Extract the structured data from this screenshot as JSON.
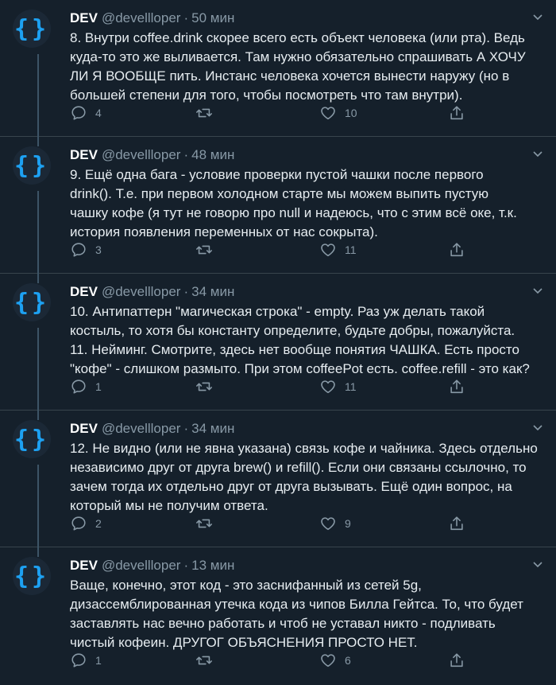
{
  "colors": {
    "background": "#15202b",
    "accent": "#1da1f2",
    "muted": "#8899a6"
  },
  "tweets": [
    {
      "avatar_text": "{}",
      "name": "DEV",
      "handle": "@devellloper",
      "separator": "·",
      "time": "50 мин",
      "text": "8. Внутри coffee.drink скорее всего есть объект человека (или рта). Ведь\nкуда-то это же выливается. Там нужно обязательно спрашивать А ХОЧУ\nЛИ Я ВООБЩЕ пить. Инстанс человека хочется вынести наружу (но в\nбольшей степени для того, чтобы посмотреть что там внутри).",
      "replies": "4",
      "retweets": "",
      "likes": "10"
    },
    {
      "avatar_text": "{}",
      "name": "DEV",
      "handle": "@devellloper",
      "separator": "·",
      "time": "48 мин",
      "text": "9. Ещё одна бага - условие проверки пустой чашки после первого\ndrink(). Т.е. при первом холодном старте мы можем выпить пустую\nчашку кофе (я тут не говорю про null и надеюсь, что с этим всё оке, т.к.\nистория появления переменных от нас сокрыта).",
      "replies": "3",
      "retweets": "",
      "likes": "11"
    },
    {
      "avatar_text": "{}",
      "name": "DEV",
      "handle": "@devellloper",
      "separator": "·",
      "time": "34 мин",
      "text": "10. Антипаттерн \"магическая строка\" - empty. Раз уж делать такой\nкостыль, то хотя бы константу определите, будьте добры, пожалуйста.\n11. Нейминг. Смотрите, здесь нет вообще понятия ЧАШКА. Есть просто\n\"кофе\" - слишком размыто. При этом coffeePot есть. coffee.refill - это как?",
      "replies": "1",
      "retweets": "",
      "likes": "11"
    },
    {
      "avatar_text": "{}",
      "name": "DEV",
      "handle": "@devellloper",
      "separator": "·",
      "time": "34 мин",
      "text": "12. Не видно (или не явна указана) связь кофе и чайника. Здесь отдельно\nнезависимо друг от друга brew() и refill(). Если они связаны ссылочно, то\nзачем тогда их отдельно друг от друга вызывать. Ещё один вопрос, на\nкоторый мы не получим ответа.",
      "replies": "2",
      "retweets": "",
      "likes": "9"
    },
    {
      "avatar_text": "{}",
      "name": "DEV",
      "handle": "@devellloper",
      "separator": "·",
      "time": "13 мин",
      "text": "Ваще, конечно, этот код - это заснифанный из сетей 5g,\nдизассемблированная утечка кода из чипов Билла Гейтса. То, что будет\nзаставлять нас вечно работать и чтоб не уставал никто - подливать\nчистый кофеин. ДРУГОГ ОБЪЯСНЕНИЯ ПРОСТО НЕТ.",
      "replies": "1",
      "retweets": "",
      "likes": "6"
    }
  ]
}
